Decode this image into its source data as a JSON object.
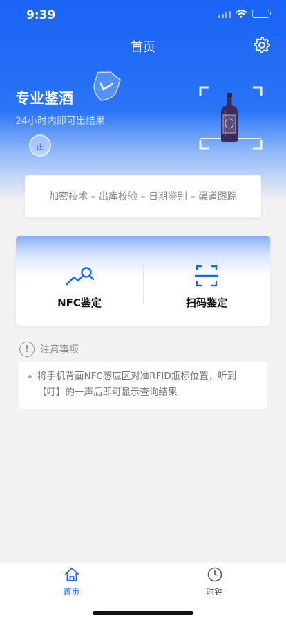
{
  "status_bar": {
    "time": "9:39"
  },
  "nav": {
    "title": "首页",
    "settings_icon": "gear-icon"
  },
  "hero": {
    "title": "专业鉴酒",
    "subtitle": "24小时内即可出结果",
    "seal_text": "正",
    "colors": {
      "primary": "#1a63f5"
    }
  },
  "features": {
    "text": "加密技术 – 出库校验 – 日期鉴别 – 渠道跟踪"
  },
  "actions": [
    {
      "label": "NFC鉴定",
      "icon": "nfc-chart-icon"
    },
    {
      "label": "扫码鉴定",
      "icon": "scan-icon"
    }
  ],
  "notice": {
    "title": "注意事项",
    "icon_text": "!",
    "items": [
      "将手机背面NFC感应区对准RFID瓶标位置，听到【叮】的一声后即可显示查询结果"
    ]
  },
  "tabbar": {
    "tabs": [
      {
        "label": "首页",
        "icon": "home-icon",
        "active": true
      },
      {
        "label": "时钟",
        "icon": "clock-icon",
        "active": false
      }
    ]
  }
}
